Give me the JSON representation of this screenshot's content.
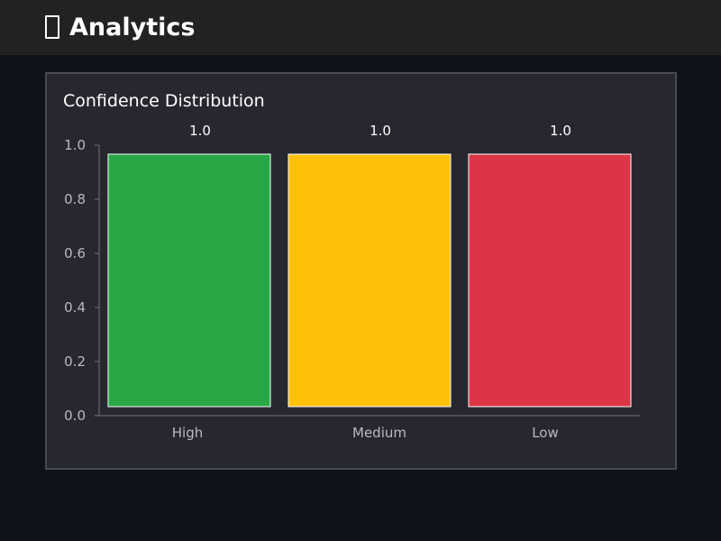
{
  "header": {
    "title": "Analytics",
    "icon": "chart-icon"
  },
  "chart_data": {
    "type": "bar",
    "title": "Confidence Distribution",
    "xlabel": "",
    "ylabel": "",
    "categories": [
      "High",
      "Medium",
      "Low"
    ],
    "values": [
      1.0,
      1.0,
      1.0
    ],
    "value_labels": [
      "1.0",
      "1.0",
      "1.0"
    ],
    "colors": [
      "#28a745",
      "#ffc107",
      "#dc3545"
    ],
    "ylim": [
      0,
      1.0
    ],
    "yticks": [
      0.0,
      0.2,
      0.4,
      0.6,
      0.8,
      1.0
    ],
    "ytick_labels": [
      "0.0",
      "0.2",
      "0.4",
      "0.6",
      "0.8",
      "1.0"
    ],
    "grid": false,
    "legend": "none"
  }
}
